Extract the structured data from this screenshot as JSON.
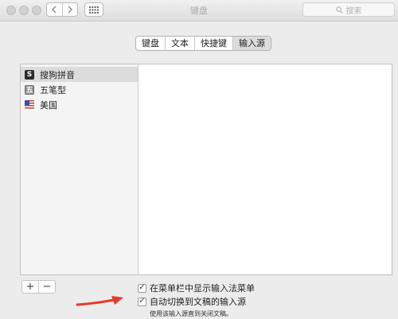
{
  "window": {
    "title": "键盘",
    "search_placeholder": "搜索",
    "nav_back_icon": "chevron-left-icon",
    "nav_forward_icon": "chevron-right-icon",
    "grid_icon": "grid-icon",
    "traffic_light_color": "#d0d0d0"
  },
  "tabs": [
    {
      "label": "键盘",
      "active": false
    },
    {
      "label": "文本",
      "active": false
    },
    {
      "label": "快捷键",
      "active": false
    },
    {
      "label": "输入源",
      "active": true
    }
  ],
  "input_sources": [
    {
      "label": "搜狗拼音",
      "icon": "sogou-icon",
      "icon_glyph": "S",
      "selected": true
    },
    {
      "label": "五笔型",
      "icon": "wubi-icon",
      "icon_glyph": "五",
      "selected": false
    },
    {
      "label": "美国",
      "icon": "us-flag-icon",
      "selected": false
    }
  ],
  "list_buttons": {
    "add": "+",
    "remove": "−"
  },
  "options": {
    "show_menu": {
      "label": "在菜单栏中显示输入法菜单",
      "checked": true
    },
    "auto_switch": {
      "label": "自动切换到文稿的输入源",
      "checked": true
    },
    "auto_switch_hint": "使用该输入源直到关闭文稿。"
  },
  "annotation": {
    "arrow_icon": "red-arrow-icon",
    "arrow_color": "#e8392c"
  }
}
